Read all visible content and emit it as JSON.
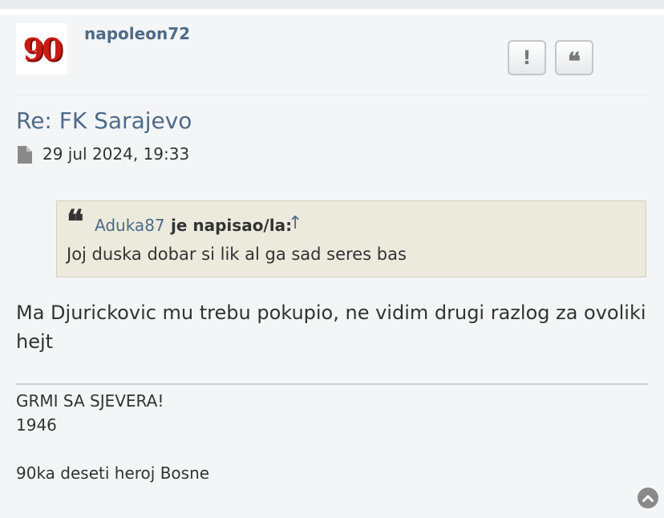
{
  "post": {
    "avatar_text": "90",
    "username": "napoleon72",
    "actions": {
      "report_glyph": "!",
      "quote_glyph": "❝"
    },
    "title": "Re: FK Sarajevo",
    "date": "29 jul 2024, 19:33",
    "quote": {
      "icon": "❝",
      "author": "Aduka87",
      "says": "je napisao/la:",
      "up_arrow": "↑",
      "text": "Joj duska dobar si lik al ga sad seres bas"
    },
    "body": "Ma Djurickovic mu trebu pokupio, ne vidim drugi razlog za ovoliki hejt",
    "signature": {
      "line1": "GRMI SA SJEVERA!",
      "line2": "1946",
      "line3": "90ka deseti heroj Bosne"
    }
  },
  "colors": {
    "link": "#4e6b87",
    "avatar_red": "#cc1b12",
    "quote_bg": "#ebeadd",
    "post_bg": "#f4f5f7"
  },
  "icons": {
    "date": "file-icon",
    "back_to_top": "chevron-up-circle-icon"
  }
}
